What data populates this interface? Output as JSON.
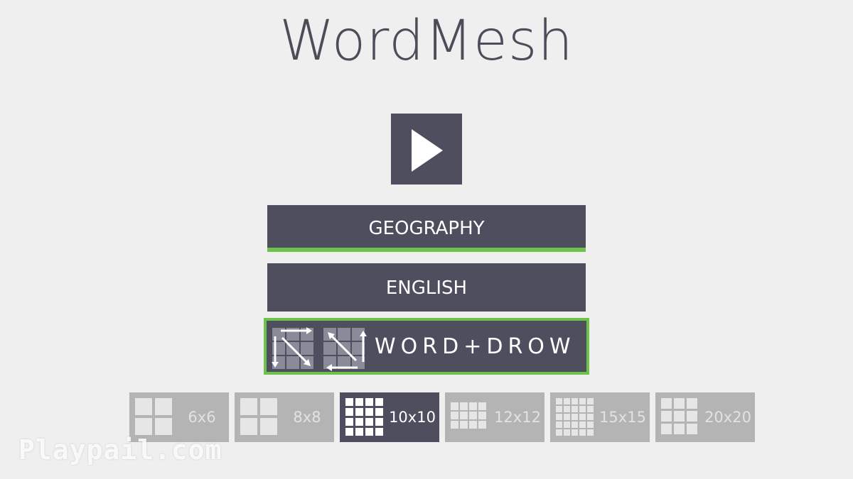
{
  "title": "WordMesh",
  "play_icon": "play-icon",
  "categories": [
    {
      "label": "GEOGRAPHY",
      "selected": true
    },
    {
      "label": "ENGLISH",
      "selected": false
    }
  ],
  "mode": {
    "label": "WORD+DROW",
    "icons": [
      "grid-arrows-forward-icon",
      "grid-arrows-reverse-icon"
    ],
    "selected": true
  },
  "grid_sizes": [
    {
      "label": "6x6",
      "cells": 2,
      "selected": false
    },
    {
      "label": "8x8",
      "cells": 2,
      "selected": false
    },
    {
      "label": "10x10",
      "cells": 4,
      "selected": true
    },
    {
      "label": "12x12",
      "cells": 4,
      "selected": false
    },
    {
      "label": "15x15",
      "cells": 5,
      "selected": false
    },
    {
      "label": "20x20",
      "cells": 3,
      "selected": false
    }
  ],
  "watermark": "Playpail.com",
  "colors": {
    "background": "#efefef",
    "button": "#4e4e5f",
    "accent_green": "#6dc24b",
    "tile_inactive": "#b4b4b4",
    "title_text": "#4d4d5a"
  }
}
